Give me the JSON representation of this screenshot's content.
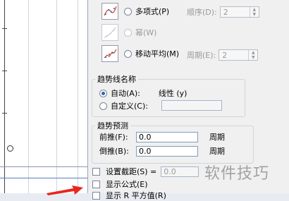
{
  "options": {
    "polynomial_label": "多项式(P)",
    "order_label": "顺序(D):",
    "order_value": "2",
    "power_label": "幂(W)",
    "moving_avg_label": "移动平均(M)",
    "period_label": "周期(E):",
    "period_value": "2"
  },
  "trend_name": {
    "title": "趋势线名称",
    "auto_label": "自动(A):",
    "auto_value": "线性 (y)",
    "custom_label": "自定义(C):",
    "custom_value": ""
  },
  "forecast": {
    "title": "趋势预测",
    "forward_label": "前推(F):",
    "forward_value": "0.0",
    "forward_unit": "周期",
    "backward_label": "倒推(B):",
    "backward_value": "0.0",
    "backward_unit": "周期"
  },
  "intercept": {
    "label": "设置截距(S) =",
    "value": "0.0"
  },
  "show_formula_label": "显示公式(E)",
  "show_r2_label": "显示 R 平方值(R)",
  "watermark": "软件技巧",
  "colors": {
    "accent": "#2b64b8",
    "arrow": "#e8261f"
  }
}
